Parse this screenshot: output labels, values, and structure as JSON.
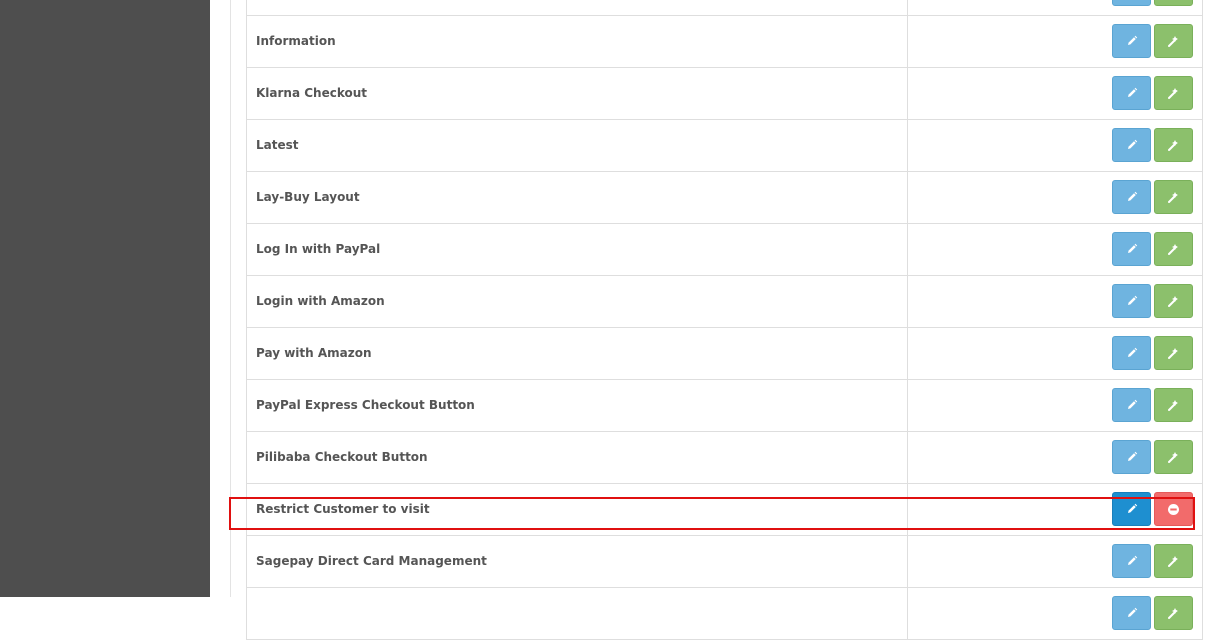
{
  "extensions": {
    "rows": [
      {
        "name": "",
        "edit_label": "edit",
        "action_label": "install",
        "action": "install"
      },
      {
        "name": "Information",
        "edit_label": "edit",
        "action_label": "install",
        "action": "install"
      },
      {
        "name": "Klarna Checkout",
        "edit_label": "edit",
        "action_label": "install",
        "action": "install"
      },
      {
        "name": "Latest",
        "edit_label": "edit",
        "action_label": "install",
        "action": "install"
      },
      {
        "name": "Lay-Buy Layout",
        "edit_label": "edit",
        "action_label": "install",
        "action": "install"
      },
      {
        "name": "Log In with PayPal",
        "edit_label": "edit",
        "action_label": "install",
        "action": "install"
      },
      {
        "name": "Login with Amazon",
        "edit_label": "edit",
        "action_label": "install",
        "action": "install"
      },
      {
        "name": "Pay with Amazon",
        "edit_label": "edit",
        "action_label": "install",
        "action": "install"
      },
      {
        "name": "PayPal Express Checkout Button",
        "edit_label": "edit",
        "action_label": "install",
        "action": "install"
      },
      {
        "name": "Pilibaba Checkout Button",
        "edit_label": "edit",
        "action_label": "install",
        "action": "install"
      },
      {
        "name": "Restrict Customer to visit",
        "edit_label": "edit",
        "action_label": "uninstall",
        "action": "uninstall",
        "highlighted": true
      },
      {
        "name": "Sagepay Direct Card Management",
        "edit_label": "edit",
        "action_label": "install",
        "action": "install"
      },
      {
        "name": "",
        "edit_label": "edit",
        "action_label": "install",
        "action": "install"
      }
    ]
  },
  "icons": {
    "edit": "pencil-icon",
    "install": "install-icon",
    "uninstall": "minus-circle-icon"
  },
  "colors": {
    "sidebar": "#4e4e4e",
    "edit_button": "#6fb4e0",
    "edit_button_active": "#1e8fd0",
    "install_button": "#8cc06c",
    "uninstall_button": "#f26b6b",
    "highlight_border": "#e01010",
    "row_text": "#555555"
  }
}
